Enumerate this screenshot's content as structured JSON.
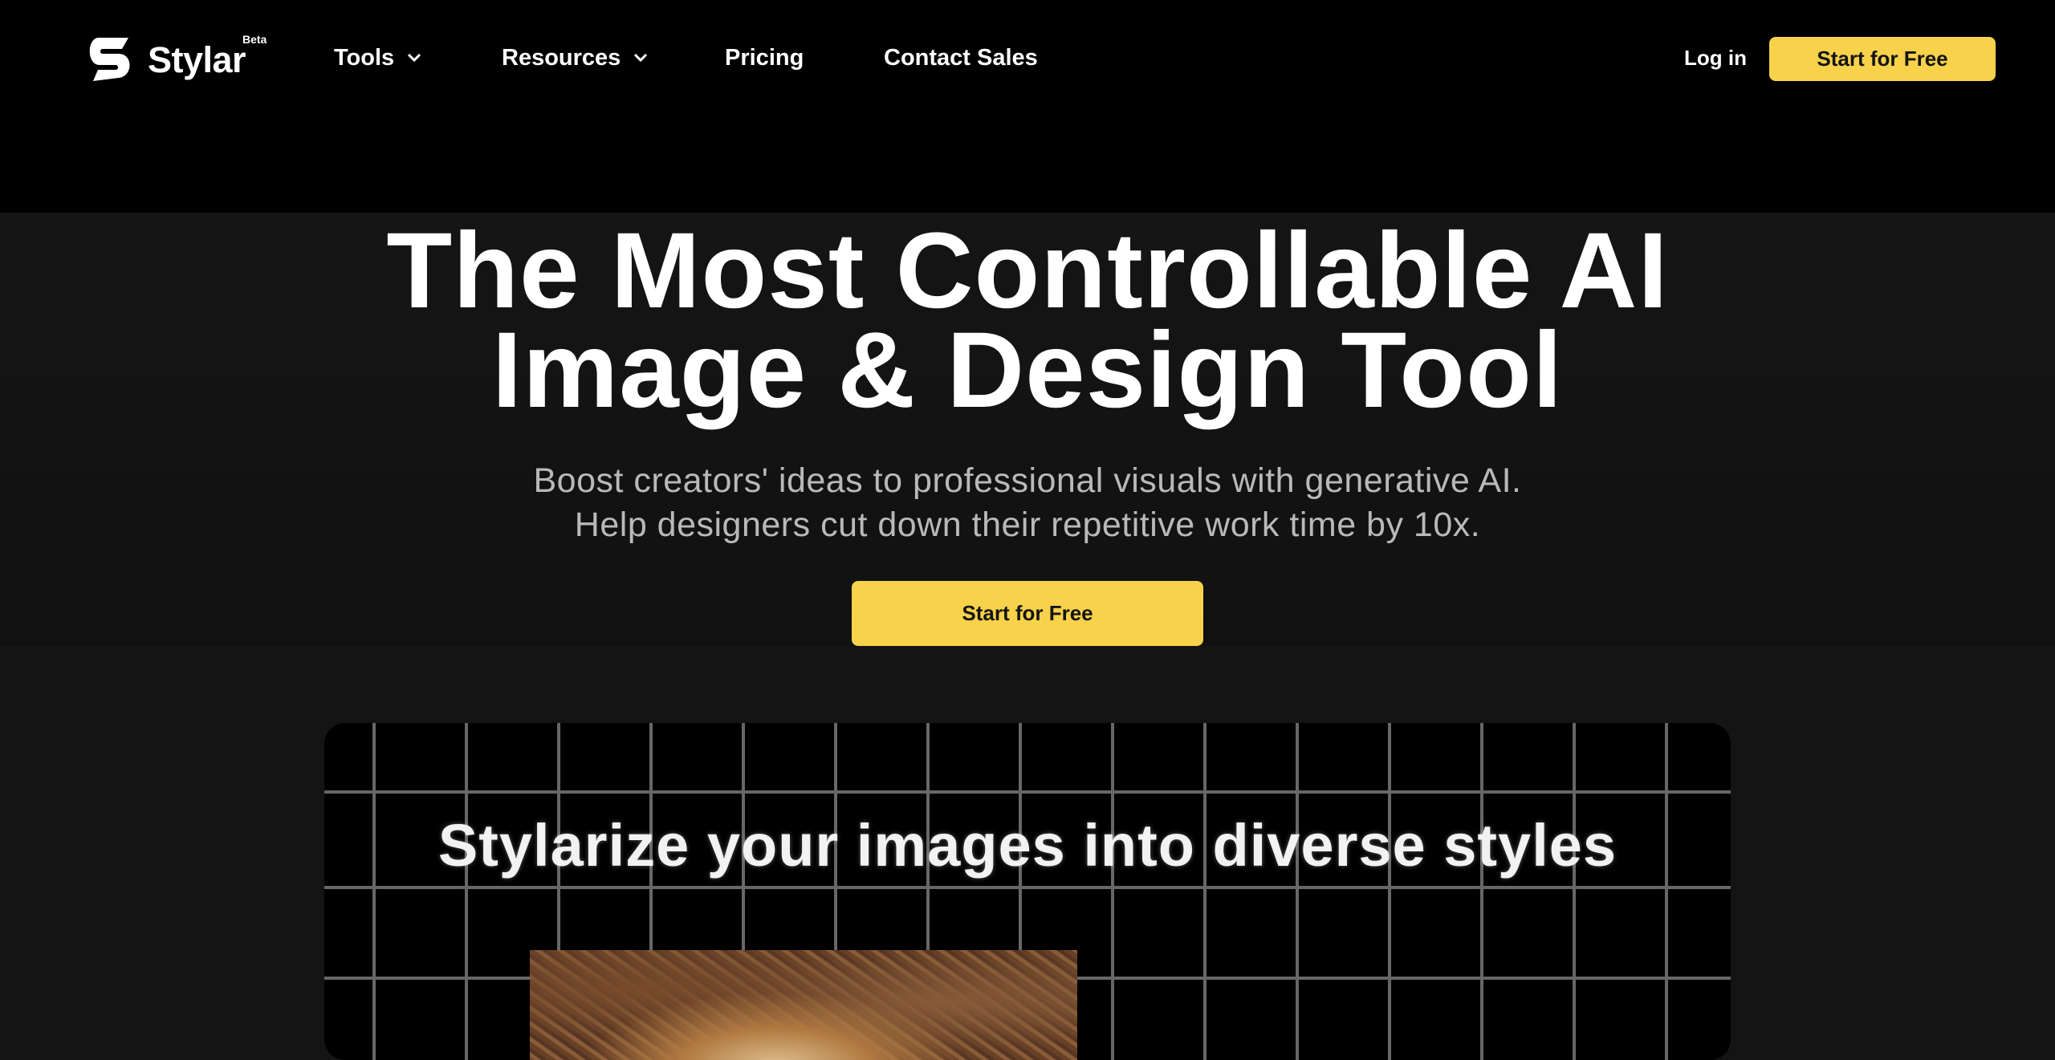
{
  "header": {
    "brand": "Stylar",
    "badge": "Beta",
    "nav": [
      {
        "label": "Tools"
      },
      {
        "label": "Resources"
      },
      {
        "label": "Pricing"
      },
      {
        "label": "Contact Sales"
      }
    ],
    "login_label": "Log in",
    "cta_label": "Start for Free"
  },
  "hero": {
    "title_line1": "The Most Controllable AI",
    "title_line2": "Image & Design Tool",
    "subtitle_line1": "Boost creators' ideas to professional visuals with generative AI.",
    "subtitle_line2": "Help designers cut down their repetitive work time by 10x.",
    "cta_label": "Start for Free"
  },
  "showcase": {
    "title": "Stylarize your images into diverse styles"
  },
  "colors": {
    "accent": "#f8d24b",
    "background": "#141414",
    "header_background": "#000000",
    "subtitle_text": "#b9b9b9"
  },
  "icons": {
    "logo": "stylar-s-logo",
    "dropdown": "chevron-down-icon"
  }
}
